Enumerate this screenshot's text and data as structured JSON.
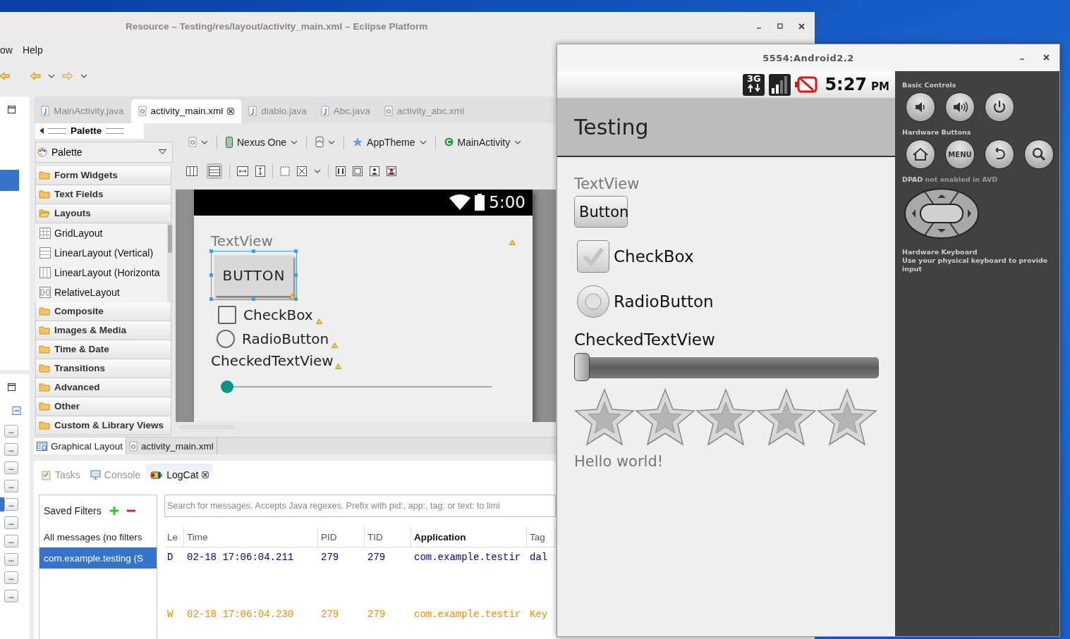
{
  "eclipse": {
    "title": "Resource – Testing/res/layout/activity_main.xml – Eclipse Platform",
    "menu": [
      "ow",
      "Help"
    ],
    "left_strip": {
      "top_rows": [
        {
          "selected": false
        },
        {
          "selected": false
        },
        {
          "selected": true
        }
      ],
      "ellipsis_buttons": [
        {
          "label": "...",
          "selected": false
        },
        {
          "label": "...",
          "selected": false
        },
        {
          "label": "...",
          "selected": false
        },
        {
          "label": "...",
          "selected": false
        },
        {
          "label": "...",
          "selected": true
        },
        {
          "label": "...",
          "selected": false
        },
        {
          "label": "...",
          "selected": false
        },
        {
          "label": "...",
          "selected": false
        },
        {
          "label": "...",
          "selected": false
        },
        {
          "label": "...",
          "selected": false
        }
      ]
    },
    "editor_tabs": [
      {
        "label": "MainActivity.java",
        "kind": "java",
        "selected": false,
        "closable": false
      },
      {
        "label": "activity_main.xml",
        "kind": "xml",
        "selected": true,
        "closable": true
      },
      {
        "label": "diablo.java",
        "kind": "java",
        "selected": false,
        "closable": false
      },
      {
        "label": "Abc.java",
        "kind": "java",
        "selected": false,
        "closable": false
      },
      {
        "label": "activity_abc.xml",
        "kind": "xml",
        "selected": false,
        "closable": false
      }
    ],
    "palette": {
      "header": "Palette",
      "dropdown": "Palette",
      "categories": [
        {
          "label": "Form Widgets",
          "expanded": false
        },
        {
          "label": "Text Fields",
          "expanded": false
        },
        {
          "label": "Layouts",
          "expanded": true,
          "children": [
            {
              "label": "GridLayout",
              "kind": "grid"
            },
            {
              "label": "LinearLayout (Vertical)",
              "kind": "rows"
            },
            {
              "label": "LinearLayout (Horizonta",
              "kind": "columns"
            },
            {
              "label": "RelativeLayout",
              "kind": "relative"
            }
          ]
        },
        {
          "label": "Composite",
          "expanded": false
        },
        {
          "label": "Images & Media",
          "expanded": false
        },
        {
          "label": "Time & Date",
          "expanded": false
        },
        {
          "label": "Transitions",
          "expanded": false
        },
        {
          "label": "Advanced",
          "expanded": false
        },
        {
          "label": "Other",
          "expanded": false
        },
        {
          "label": "Custom & Library Views",
          "expanded": false
        }
      ]
    },
    "layout_toolbar": {
      "device": "Nexus One",
      "theme": "AppTheme",
      "activity": "MainActivity",
      "view_modes": [
        {
          "kind": "columns",
          "selected": false
        },
        {
          "kind": "rows",
          "selected": true
        }
      ]
    },
    "preview": {
      "time": "5:00",
      "widgets": [
        {
          "kind": "textview",
          "text": "TextView",
          "warning": true
        },
        {
          "kind": "button",
          "text": "BUTTON",
          "selected": true,
          "warning": true
        },
        {
          "kind": "checkbox",
          "text": "CheckBox",
          "checked": false,
          "warning": true
        },
        {
          "kind": "radio",
          "text": "RadioButton",
          "checked": false,
          "warning": true
        },
        {
          "kind": "checkedtext",
          "text": "CheckedTextView",
          "warning": true
        },
        {
          "kind": "seekbar",
          "level": 0
        }
      ]
    },
    "editor_bottom_tabs": [
      {
        "label": "Graphical Layout",
        "kind": "layout",
        "selected": true
      },
      {
        "label": "activity_main.xml",
        "kind": "xml",
        "selected": false
      }
    ],
    "bottom_tabs": [
      {
        "label": "Tasks",
        "kind": "tasks",
        "selected": false
      },
      {
        "label": "Console",
        "kind": "console",
        "selected": false
      },
      {
        "label": "LogCat",
        "kind": "logcat",
        "selected": true
      }
    ],
    "logcat": {
      "filters_title": "Saved Filters",
      "filters": [
        {
          "label": "All messages (no filters",
          "selected": false
        },
        {
          "label": "com.example.testing (S",
          "selected": true
        }
      ],
      "search": {
        "placeholder": "Search for messages. Accepts Java regexes. Prefix with pid:, app:, tag: or text: to limi"
      },
      "columns": [
        {
          "label": "Le",
          "sorted": false
        },
        {
          "label": "Time",
          "sorted": false
        },
        {
          "label": "PID",
          "sorted": false
        },
        {
          "label": "TID",
          "sorted": false
        },
        {
          "label": "Application",
          "sorted": true
        },
        {
          "label": "Tag",
          "sorted": false
        }
      ],
      "rows": [
        {
          "color": "#00008b",
          "cells": [
            "D",
            "02-18 17:06:04.211",
            "279",
            "279",
            "com.example.testir",
            "dal"
          ]
        },
        {
          "color": "#ff8c00",
          "cells": [
            "W",
            "02-18 17:06:04.230",
            "279",
            "279",
            "com.example.testir",
            "Key"
          ]
        }
      ]
    }
  },
  "emulator": {
    "title": "5554:Android2.2",
    "status": {
      "network": "3G",
      "time": "5:27",
      "ampm": "PM"
    },
    "app_title": "Testing",
    "widgets": [
      {
        "kind": "textview",
        "text": "TextView"
      },
      {
        "kind": "button",
        "text": "Button"
      },
      {
        "kind": "checkbox",
        "text": "CheckBox",
        "checked": false
      },
      {
        "kind": "radio",
        "text": "RadioButton",
        "checked": false
      },
      {
        "kind": "label",
        "text": "CheckedTextView"
      },
      {
        "kind": "seekbar",
        "level": 0
      },
      {
        "kind": "rating",
        "stars": 0
      },
      {
        "kind": "textview",
        "text": "Hello world!"
      }
    ],
    "controls": {
      "basic_title": "Basic Controls",
      "basic": [
        {
          "kind": "volume-down"
        },
        {
          "kind": "volume-up"
        },
        {
          "kind": "power"
        }
      ],
      "hardware_title": "Hardware Buttons",
      "hardware": [
        {
          "kind": "home"
        },
        {
          "kind": "menu",
          "label": "MENU"
        },
        {
          "kind": "back"
        },
        {
          "kind": "search"
        }
      ],
      "dpad_note": "**DPAD** not enabled in AVD",
      "keyboard_title": "Hardware Keyboard",
      "keyboard_note": "Use your physical keyboard to provide input"
    }
  }
}
